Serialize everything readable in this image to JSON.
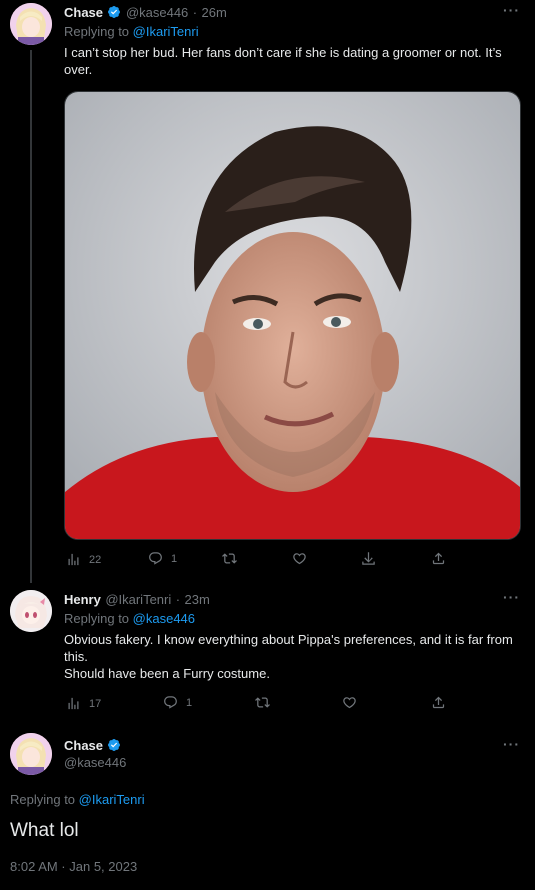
{
  "tweet1": {
    "name": "Chase",
    "handle": "@kase446",
    "time": "26m",
    "reply_prefix": "Replying to",
    "reply_to": "@IkariTenri",
    "text": "I can’t stop her bud. Her fans don’t care if she is dating a groomer or not. It’s over.",
    "views": "22",
    "replies": "1"
  },
  "tweet2": {
    "name": "Henry",
    "handle": "@IkariTenri",
    "time": "23m",
    "reply_prefix": "Replying to",
    "reply_to": "@kase446",
    "text_line1": "Obvious fakery. I know everything about Pippa's preferences, and it is far from this.",
    "text_line2": "Should have been a Furry costume.",
    "views": "17",
    "replies": "1"
  },
  "tweet3": {
    "name": "Chase",
    "handle": "@kase446",
    "reply_prefix": "Replying to",
    "reply_to": "@IkariTenri",
    "text": "What lol",
    "timestamp": "8:02 AM · Jan 5, 2023"
  },
  "separator": "·",
  "colors": {
    "accent": "#1d9bf0",
    "muted": "#71767b",
    "text": "#e7e9ea",
    "bg": "#000000"
  }
}
